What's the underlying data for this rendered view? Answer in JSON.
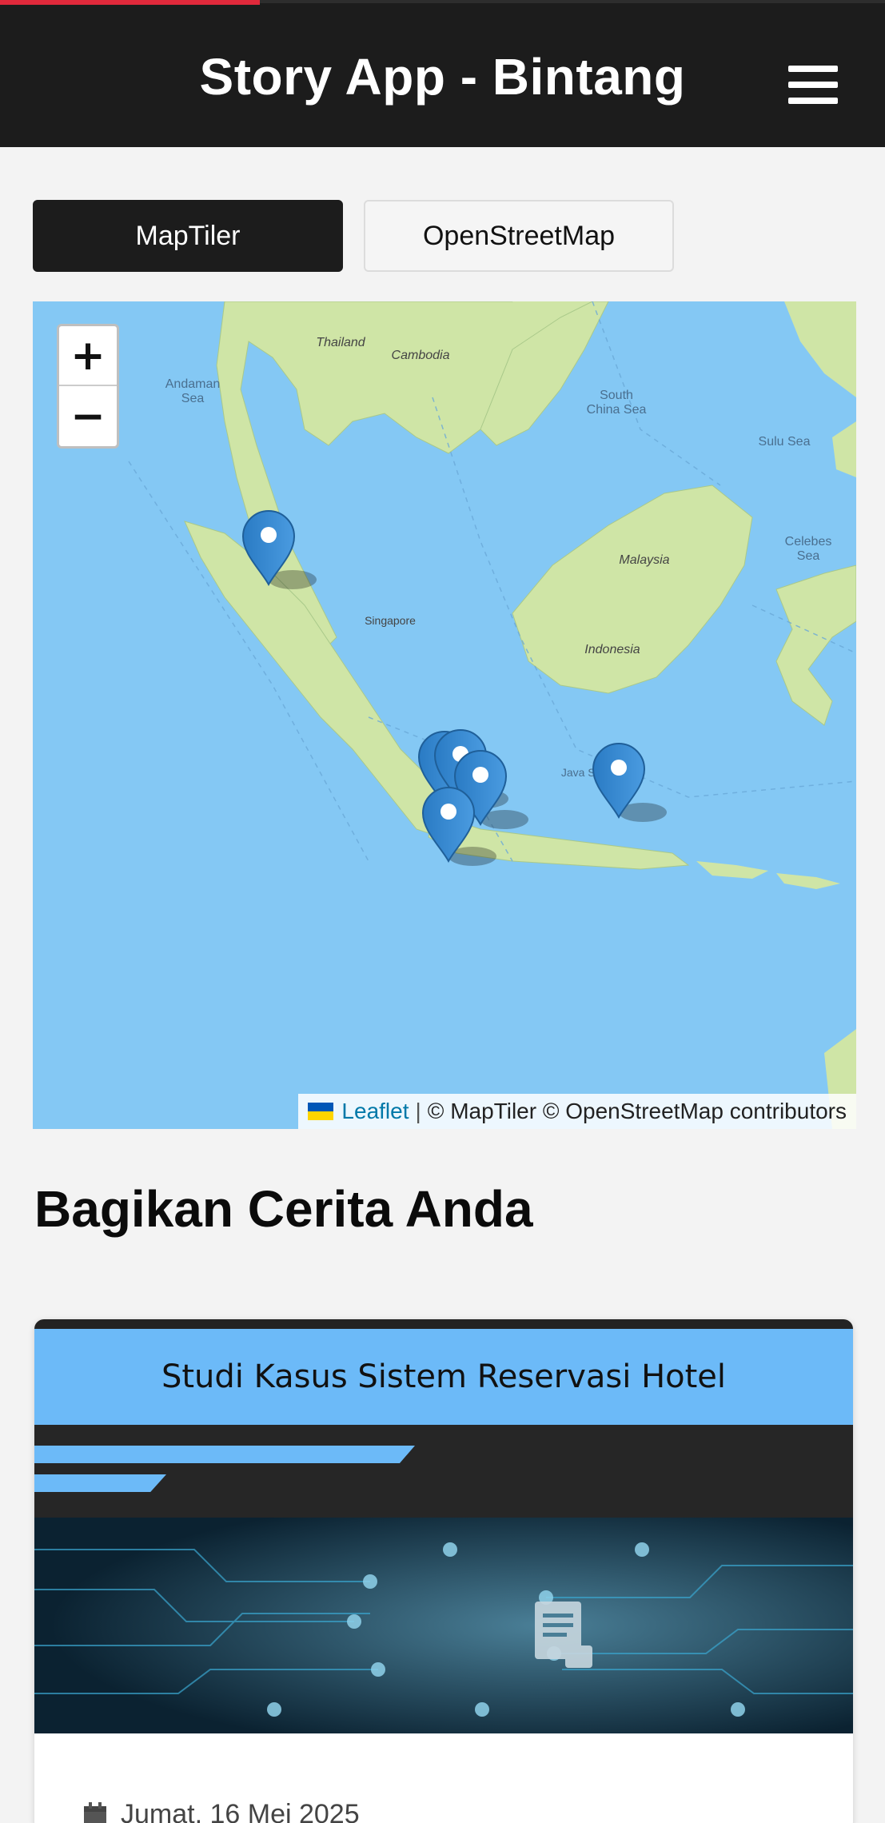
{
  "header": {
    "title": "Story App - Bintang",
    "menu_icon": "hamburger-menu-icon",
    "background": "#1c1c1c",
    "progress_color": "#e0293b"
  },
  "map_layers": {
    "active": "MapTiler",
    "options": [
      "MapTiler",
      "OpenStreetMap"
    ]
  },
  "map": {
    "zoom_in": "+",
    "zoom_out": "−",
    "labels": {
      "thailand": "Thailand",
      "cambodia": "Cambodia",
      "andaman_sea_1": "Andaman",
      "andaman_sea_2": "Sea",
      "south_china_sea_1": "South",
      "south_china_sea_2": "China Sea",
      "sulu_sea": "Sulu Sea",
      "celebes_1": "Celebes",
      "celebes_2": "Sea",
      "malaysia": "Malaysia",
      "indonesia": "Indonesia",
      "singapore": "Singapore",
      "java_sea": "Java Sea"
    },
    "marker_count": 6,
    "attribution": {
      "leaflet": "Leaflet",
      "separator": "|",
      "text": "© MapTiler © OpenStreetMap contributors"
    },
    "water_color": "#84c8f4",
    "land_color": "#cfe5a6"
  },
  "section": {
    "title": "Bagikan Cerita Anda"
  },
  "stories": [
    {
      "title": "Studi Kasus Sistem Reservasi Hotel",
      "date": "Jumat, 16 Mei 2025",
      "date_icon": "calendar-icon",
      "accent": "#6cbaf8"
    }
  ]
}
